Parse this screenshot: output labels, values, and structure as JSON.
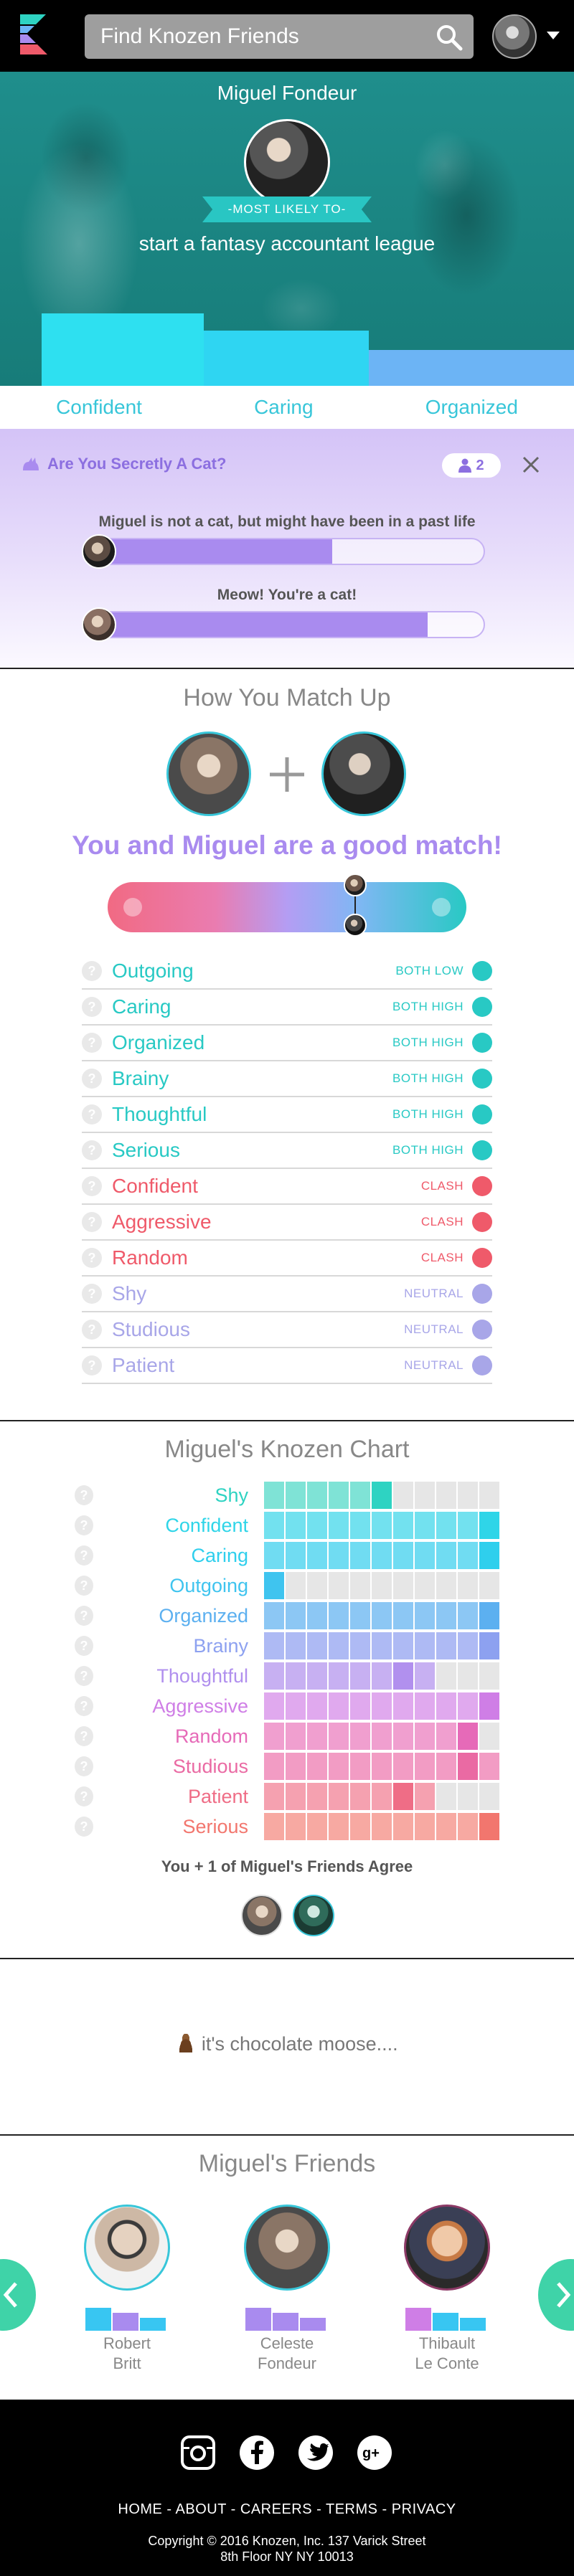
{
  "header": {
    "search_placeholder": "Find Knozen Friends",
    "colors": {
      "bar": "#000000",
      "search": "#9e9e9e"
    }
  },
  "hero": {
    "name": "Miguel Fondeur",
    "ribbon": "-MOST LIKELY TO-",
    "text": "start a fantasy accountant league",
    "bars": [
      {
        "label": "Confident",
        "level": 0.42,
        "color": "#2ee0f0"
      },
      {
        "label": "Caring",
        "level": 0.32,
        "color": "#2fd5f2"
      },
      {
        "label": "Organized",
        "level": 0.21,
        "color": "#6cb4f5"
      }
    ]
  },
  "quiz": {
    "title": "Are You Secretly A Cat?",
    "count": "2",
    "results": [
      {
        "text": "Miguel is not a cat, but might have been in a past life",
        "level": 0.62
      },
      {
        "text": "Meow! You're a cat!",
        "level": 0.86
      }
    ]
  },
  "match": {
    "title": "How You Match Up",
    "headline": "You and Miguel are a good match!",
    "traits": [
      {
        "name": "Outgoing",
        "relation": "BOTH LOW",
        "kind": "good"
      },
      {
        "name": "Caring",
        "relation": "BOTH HIGH",
        "kind": "good"
      },
      {
        "name": "Organized",
        "relation": "BOTH HIGH",
        "kind": "good"
      },
      {
        "name": "Brainy",
        "relation": "BOTH HIGH",
        "kind": "good"
      },
      {
        "name": "Thoughtful",
        "relation": "BOTH HIGH",
        "kind": "good"
      },
      {
        "name": "Serious",
        "relation": "BOTH HIGH",
        "kind": "good"
      },
      {
        "name": "Confident",
        "relation": "CLASH",
        "kind": "clash"
      },
      {
        "name": "Aggressive",
        "relation": "CLASH",
        "kind": "clash"
      },
      {
        "name": "Random",
        "relation": "CLASH",
        "kind": "clash"
      },
      {
        "name": "Shy",
        "relation": "NEUTRAL",
        "kind": "neutral"
      },
      {
        "name": "Studious",
        "relation": "NEUTRAL",
        "kind": "neutral"
      },
      {
        "name": "Patient",
        "relation": "NEUTRAL",
        "kind": "neutral"
      }
    ],
    "colors": {
      "good": "#28c9c4",
      "clash": "#ef5a6a",
      "neutral": "#a8a6e8"
    }
  },
  "chart": {
    "title": "Miguel's Knozen Chart",
    "rows": [
      {
        "name": "Shy",
        "color": "#2ed3c2",
        "light": "#7fe3d6",
        "filled": 6,
        "highlight": 6
      },
      {
        "name": "Confident",
        "color": "#2fd5e8",
        "light": "#72e1ef",
        "filled": 11,
        "highlight": 11
      },
      {
        "name": "Caring",
        "color": "#2fcfed",
        "light": "#70dcf2",
        "filled": 11,
        "highlight": 11
      },
      {
        "name": "Outgoing",
        "color": "#3fc4ef",
        "light": "#66cff2",
        "filled": 1,
        "highlight": 1
      },
      {
        "name": "Organized",
        "color": "#5cb0f0",
        "light": "#8cc7f4",
        "filled": 11,
        "highlight": 11
      },
      {
        "name": "Brainy",
        "color": "#8da1f0",
        "light": "#aebaf4",
        "filled": 11,
        "highlight": 11
      },
      {
        "name": "Thoughtful",
        "color": "#b190ee",
        "light": "#c7b0f2",
        "filled": 8,
        "highlight": 7
      },
      {
        "name": "Aggressive",
        "color": "#cf7ee6",
        "light": "#e0a9ee",
        "filled": 11,
        "highlight": 11
      },
      {
        "name": "Random",
        "color": "#e66ab8",
        "light": "#f09fcf",
        "filled": 10,
        "highlight": 10
      },
      {
        "name": "Studious",
        "color": "#ea6aa3",
        "light": "#f29cc4",
        "filled": 11,
        "highlight": 10
      },
      {
        "name": "Patient",
        "color": "#ef6d86",
        "light": "#f5a1b0",
        "filled": 8,
        "highlight": 7
      },
      {
        "name": "Serious",
        "color": "#f2766e",
        "light": "#f7a9a2",
        "filled": 11,
        "highlight": 11
      }
    ],
    "agree_text": "You + 1 of Miguel's Friends Agree"
  },
  "comment": {
    "text": "it's chocolate moose....",
    "icon": "poop-emoji-icon"
  },
  "friends": {
    "title": "Miguel's Friends",
    "list": [
      {
        "first": "Robert",
        "last": "Britt",
        "border": "#38c6d9",
        "bars": [
          {
            "level": 0.9,
            "color": "#38c6f2"
          },
          {
            "level": 0.7,
            "color": "#a98bef"
          },
          {
            "level": 0.5,
            "color": "#38c6f2"
          }
        ]
      },
      {
        "first": "Celeste",
        "last": "Fondeur",
        "border": "#38c6d9",
        "bars": [
          {
            "level": 0.9,
            "color": "#a98bef"
          },
          {
            "level": 0.7,
            "color": "#a98bef"
          },
          {
            "level": 0.5,
            "color": "#a98bef"
          }
        ]
      },
      {
        "first": "Thibault",
        "last": "Le Conte",
        "border": "#8c3a66",
        "bars": [
          {
            "level": 0.9,
            "color": "#cf7ee6"
          },
          {
            "level": 0.7,
            "color": "#38c6f2"
          },
          {
            "level": 0.5,
            "color": "#38c6f2"
          }
        ]
      }
    ]
  },
  "footer": {
    "social": [
      "instagram-icon",
      "facebook-icon",
      "twitter-icon",
      "google-plus-icon"
    ],
    "nav": [
      "HOME",
      "ABOUT",
      "CAREERS",
      "TERMS",
      "PRIVACY"
    ],
    "nav_sep": " - ",
    "copyright_1": "Copyright © 2016 Knozen, Inc. 137 Varick Street",
    "copyright_2": "8th Floor NY NY 10013"
  }
}
